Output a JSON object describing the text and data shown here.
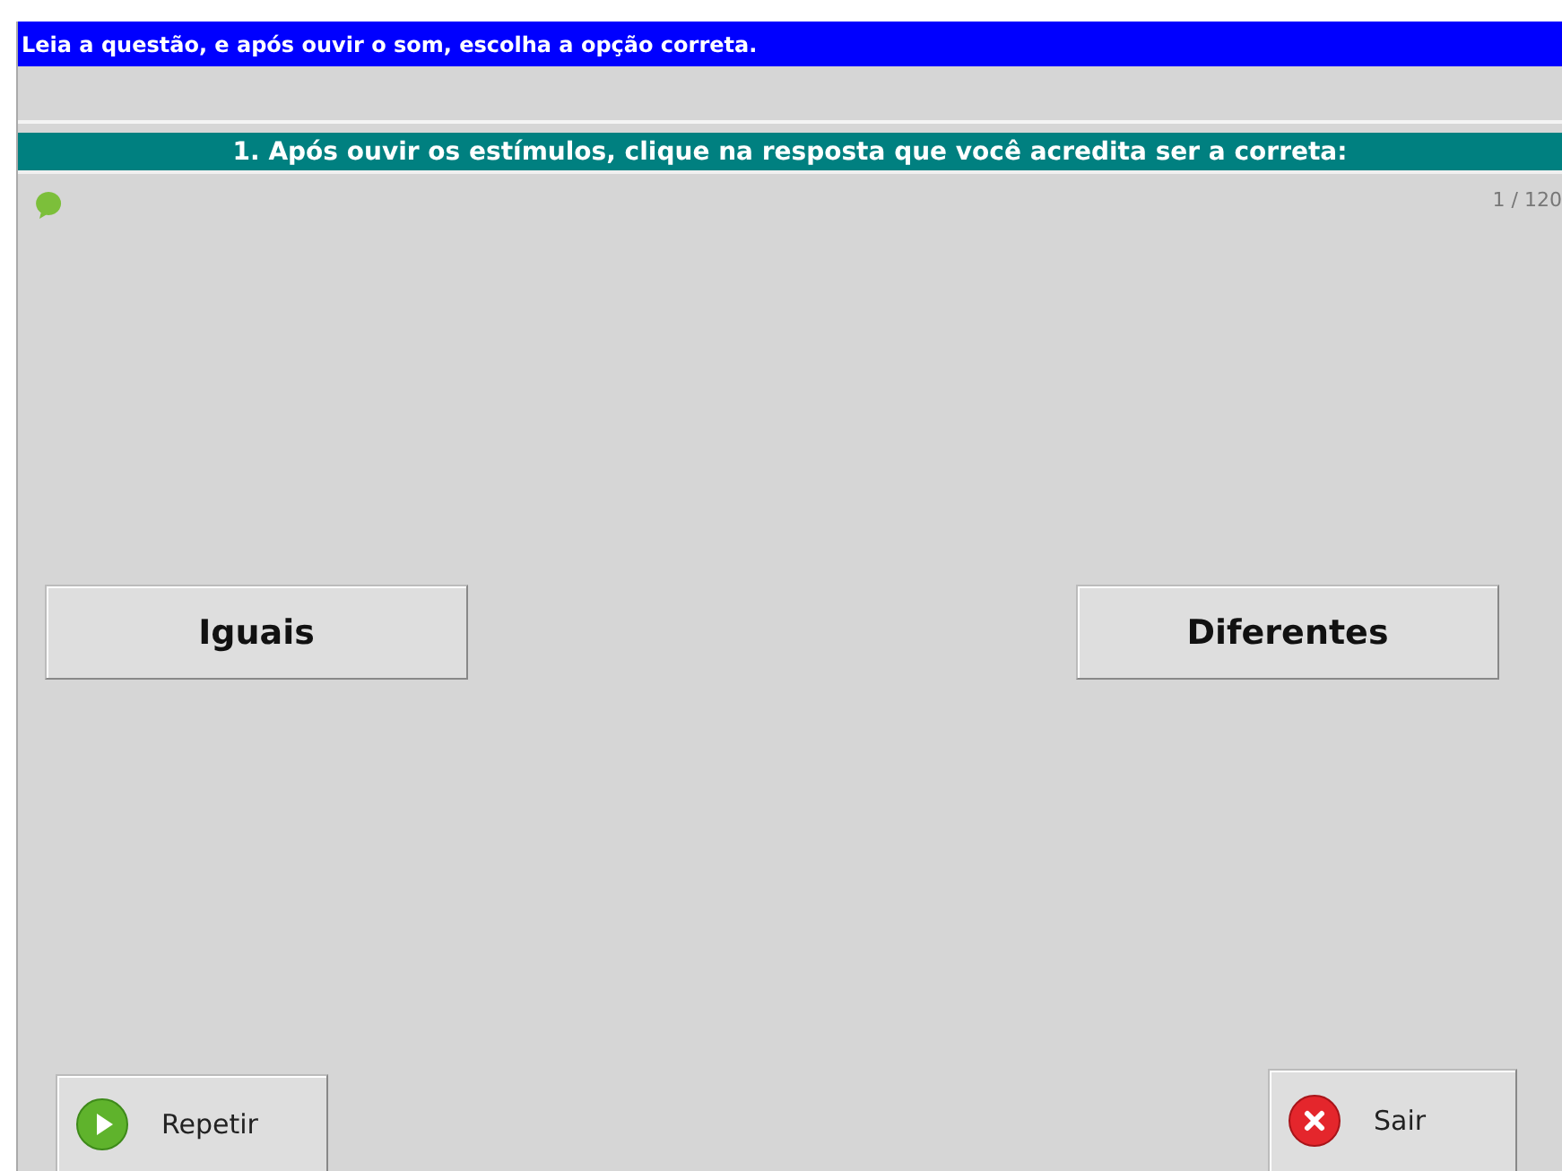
{
  "window": {
    "title": "Leia a questão, e após ouvir o som, escolha a opção correta."
  },
  "question": {
    "text": "1. Após ouvir os estímulos, clique na resposta que você acredita ser a correta:",
    "counter": "1 / 120"
  },
  "answers": [
    {
      "label": "Iguais"
    },
    {
      "label": "Diferentes"
    }
  ],
  "footer_buttons": [
    {
      "label": "Repetir",
      "kind": "play"
    },
    {
      "label": "Sair",
      "kind": "exit"
    }
  ]
}
